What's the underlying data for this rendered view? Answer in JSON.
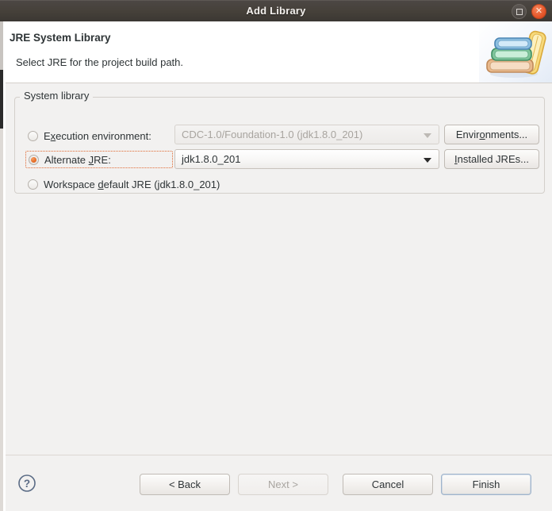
{
  "window": {
    "title": "Add Library",
    "maximize_icon": "maximize-icon",
    "close_icon": "close-icon",
    "close_glyph": "✕"
  },
  "header": {
    "title": "JRE System Library",
    "description": "Select JRE for the project build path.",
    "icon": "book-stack-icon"
  },
  "group": {
    "legend": "System library",
    "options": [
      {
        "label_pre": "E",
        "label_mnemonic": "x",
        "label_post": "ecution environment:",
        "full_label": "Execution environment:",
        "selected": false,
        "enabled": false
      },
      {
        "label_pre": "Alternate ",
        "label_mnemonic": "J",
        "label_post": "RE:",
        "full_label": "Alternate JRE:",
        "selected": true,
        "enabled": true
      },
      {
        "label_pre": "Workspace ",
        "label_mnemonic": "d",
        "label_post": "efault JRE (jdk1.8.0_201)",
        "full_label": "Workspace default JRE (jdk1.8.0_201)",
        "selected": false,
        "enabled": true
      }
    ],
    "combo_execution_environment": {
      "value": "CDC-1.0/Foundation-1.0 (jdk1.8.0_201)",
      "enabled": false,
      "arrow_icon": "chevron-down-icon"
    },
    "combo_alternate_jre": {
      "value": "jdk1.8.0_201",
      "enabled": true,
      "arrow_icon": "chevron-down-icon"
    },
    "button_environments": {
      "label_pre": "Envir",
      "label_mnemonic": "o",
      "label_post": "nments...",
      "full_label": "Environments..."
    },
    "button_installed_jres": {
      "label_pre": "",
      "label_mnemonic": "I",
      "label_post": "nstalled JREs...",
      "full_label": "Installed JREs..."
    }
  },
  "footer": {
    "help_icon": "help-question-icon",
    "buttons": [
      {
        "label": "< Back",
        "enabled": true,
        "default": false
      },
      {
        "label": "Next >",
        "enabled": false,
        "default": false
      },
      {
        "label": "Cancel",
        "enabled": true,
        "default": false
      },
      {
        "label": "Finish",
        "enabled": true,
        "default": true
      }
    ]
  },
  "colors": {
    "titlebar": "#46413d",
    "accent_orange": "#e8702a",
    "focus_border": "#e06a33",
    "body_bg": "#f2f1f0",
    "header_bg": "#ffffff",
    "text": "#2e3436",
    "text_disabled": "#a8a49f",
    "default_button_border": "#9fb4cc"
  }
}
